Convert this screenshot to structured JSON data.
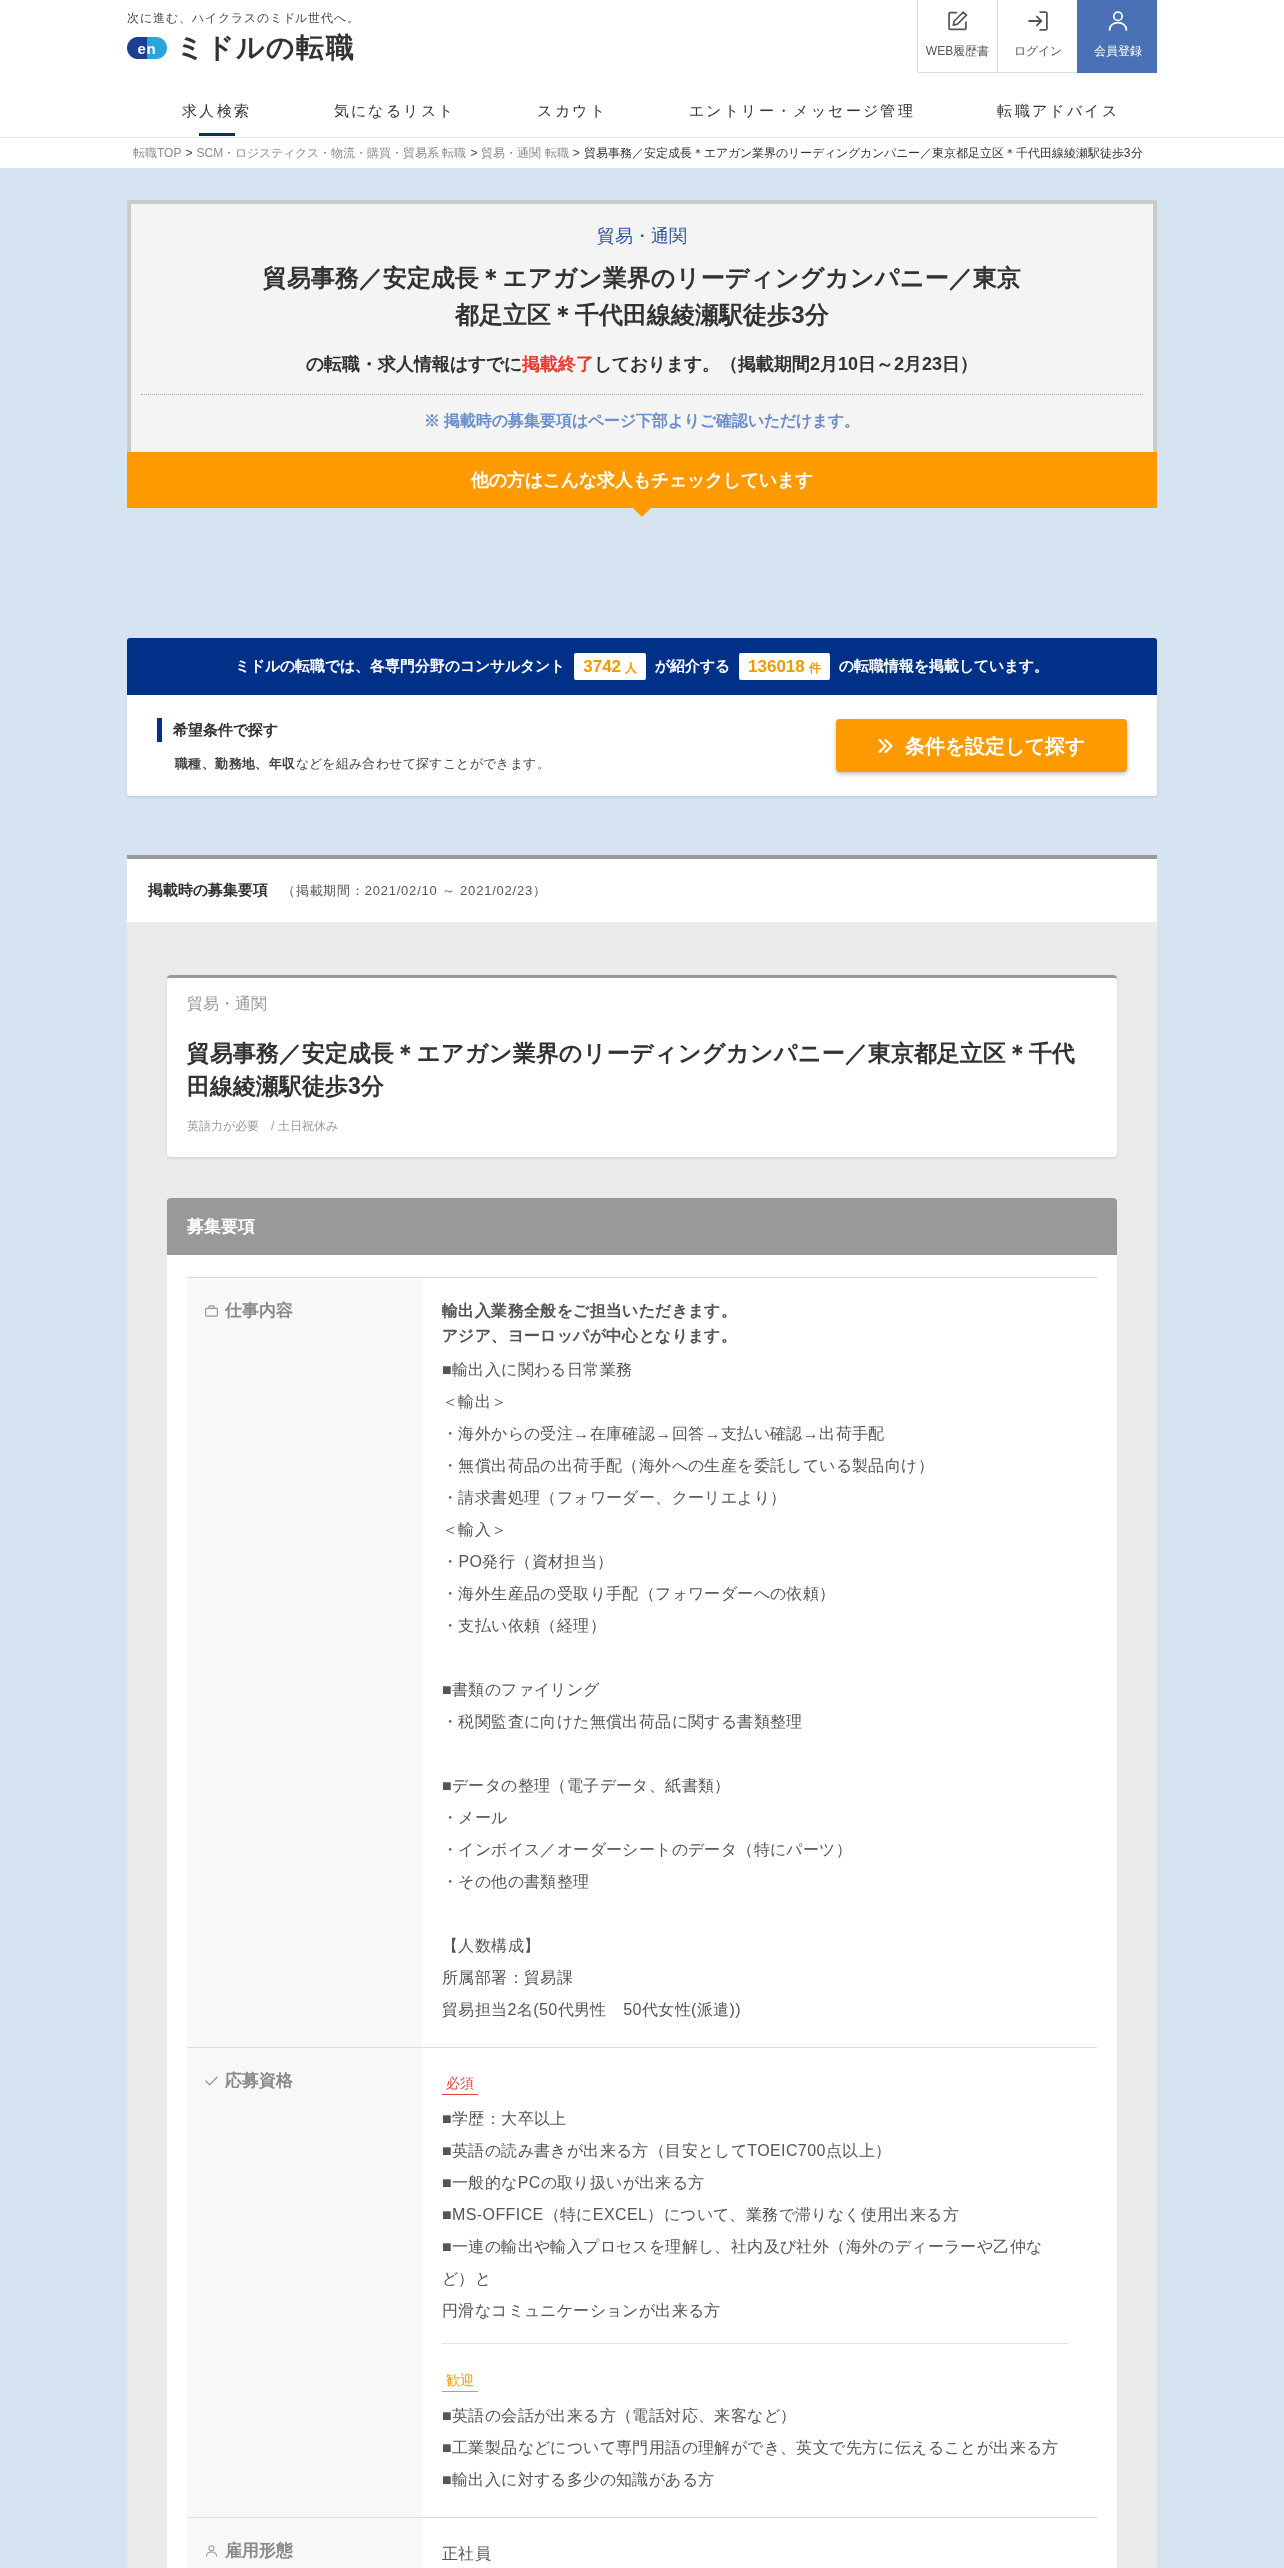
{
  "header": {
    "tagline": "次に進む、ハイクラスのミドル世代へ。",
    "logo": {
      "mark": "en",
      "name": "ミドルの転職"
    },
    "actions": [
      {
        "kind": "resume",
        "label": "WEB履歴書",
        "highlighted": false
      },
      {
        "kind": "login",
        "label": "ログイン",
        "highlighted": false
      },
      {
        "kind": "register",
        "label": "会員登録",
        "highlighted": true
      }
    ]
  },
  "nav": [
    {
      "label": "求人検索",
      "selected": true
    },
    {
      "label": "気になるリスト",
      "selected": false
    },
    {
      "label": "スカウト",
      "selected": false
    },
    {
      "label": "エントリー・メッセージ管理",
      "selected": false
    },
    {
      "label": "転職アドバイス",
      "selected": false
    }
  ],
  "breadcrumb": {
    "separator": ">",
    "items": [
      {
        "label": "転職TOP",
        "current": false
      },
      {
        "label": "SCM・ロジスティクス・物流・購買・貿易系 転職",
        "current": false
      },
      {
        "label": "貿易・通関 転職",
        "current": false
      },
      {
        "label": "貿易事務／安定成長＊エアガン業界のリーディングカンパニー／東京都足立区＊千代田線綾瀬駅徒歩3分",
        "current": true
      }
    ]
  },
  "closed_notice": {
    "category": "貿易・通関",
    "title": "貿易事務／安定成長＊エアガン業界のリーディングカンパニー／東京都足立区＊千代田線綾瀬駅徒歩3分",
    "status": [
      {
        "text": "の転職・求人情報はすでに",
        "emphasis": false
      },
      {
        "text": "掲載終了",
        "emphasis": true
      },
      {
        "text": "しております。（掲載期間2月10日～2月23日）",
        "emphasis": false
      }
    ],
    "note": "※ 掲載時の募集要項はページ下部よりご確認いただけます。",
    "related_banner": "他の方はこんな求人もチェックしています"
  },
  "stats_banner": [
    {
      "kind": "text",
      "text": "ミドルの転職では、各専門分野のコンサルタント"
    },
    {
      "kind": "count",
      "value": "3742",
      "unit": "人"
    },
    {
      "kind": "text",
      "text": "が紹介する"
    },
    {
      "kind": "count",
      "value": "136018",
      "unit": "件"
    },
    {
      "kind": "text",
      "text": "の転職情報を掲載しています。"
    }
  ],
  "condition_search": {
    "title": "希望条件で探す",
    "description": "**職種、勤務地、年収**などを組み合わせて探すことができます。",
    "button": "条件を設定して探す"
  },
  "posting": {
    "title": "掲載時の募集要項",
    "period": "（掲載期間：2021/02/10 ～ 2021/02/23）",
    "summary": {
      "category": "貿易・通関",
      "title": "貿易事務／安定成長＊エアガン業界のリーディングカンパニー／東京都足立区＊千代田線綾瀬駅徒歩3分",
      "tags": "英語力が必要　/ 土日祝休み"
    },
    "details_title": "募集要項",
    "rows": [
      {
        "label": "仕事内容",
        "blocks": [
          {
            "kind": "lead",
            "lines": [
              "輸出入業務全般をご担当いただきます。",
              "アジア、ヨーロッパが中心となります。"
            ]
          },
          {
            "kind": "list",
            "lines": [
              "■輸出入に関わる日常業務",
              "＜輸出＞",
              "・海外からの受注→在庫確認→回答→支払い確認→出荷手配",
              "・無償出荷品の出荷手配（海外への生産を委託している製品向け）",
              "・請求書処理（フォワーダー、クーリエより）",
              "＜輸入＞",
              "・PO発行（資材担当）",
              "・海外生産品の受取り手配（フォワーダーへの依頼）",
              "・支払い依頼（経理）"
            ]
          },
          {
            "kind": "list",
            "lines": [
              "■書類のファイリング",
              "・税関監査に向けた無償出荷品に関する書類整理"
            ]
          },
          {
            "kind": "list",
            "lines": [
              "■データの整理（電子データ、紙書類）",
              "・メール",
              "・インボイス／オーダーシートのデータ（特にパーツ）",
              "・その他の書類整理"
            ]
          },
          {
            "kind": "list",
            "lines": [
              "【人数構成】",
              "所属部署：貿易課",
              "貿易担当2名(50代男性　50代女性(派遣))"
            ]
          }
        ]
      },
      {
        "label": "応募資格",
        "blocks": [
          {
            "kind": "required",
            "tag": "必須",
            "lines": [
              "■学歴：大卒以上",
              "■英語の読み書きが出来る方（目安としてTOEIC700点以上）",
              "■一般的なPCの取り扱いが出来る方",
              "■MS-OFFICE（特にEXCEL）について、業務で滞りなく使用出来る方",
              "■一連の輸出や輸入プロセスを理解し、社内及び社外（海外のディーラーや乙仲など）と",
              "円滑なコミュニケーションが出来る方"
            ]
          },
          {
            "kind": "preferred",
            "tag": "歓迎",
            "lines": [
              "■英語の会話が出来る方（電話対応、来客など）",
              "■工業製品などについて専門用語の理解ができ、英文で先方に伝えることが出来る方",
              "■輸出入に対する多少の知識がある方"
            ]
          }
        ]
      },
      {
        "label": "雇用形態",
        "blocks": [
          {
            "kind": "list",
            "lines": [
              "正社員"
            ]
          }
        ]
      }
    ]
  }
}
